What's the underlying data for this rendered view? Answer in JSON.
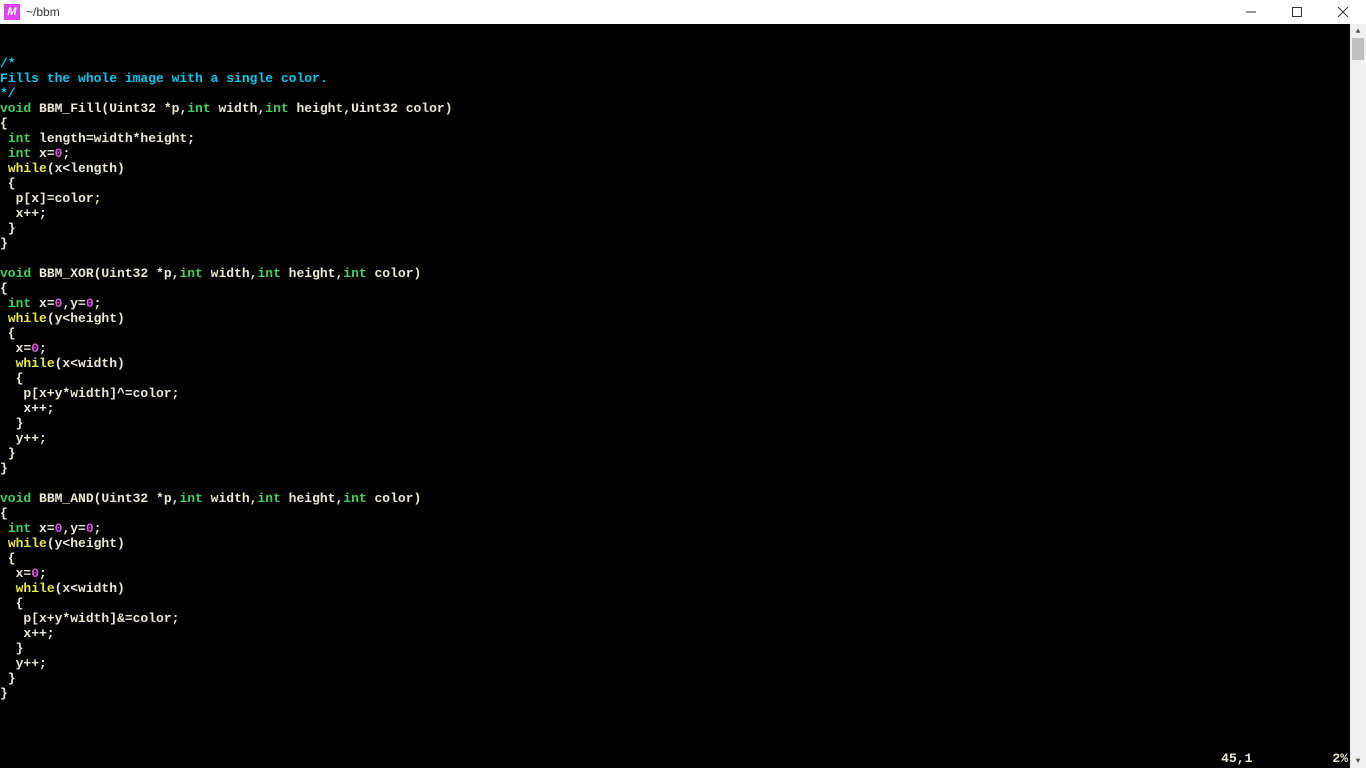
{
  "window": {
    "title": "~/bbm",
    "icon_glyph": "M"
  },
  "code": {
    "lines": [
      {
        "tokens": [
          {
            "t": "/*",
            "c": "c-comment"
          }
        ]
      },
      {
        "tokens": [
          {
            "t": "Fills the whole image with a single color.",
            "c": "c-comment"
          }
        ]
      },
      {
        "tokens": [
          {
            "t": "*/",
            "c": "c-comment"
          }
        ]
      },
      {
        "tokens": [
          {
            "t": "void",
            "c": "c-type"
          },
          {
            "t": " BBM_Fill(Uint32 *p,"
          },
          {
            "t": "int",
            "c": "c-type"
          },
          {
            "t": " width,"
          },
          {
            "t": "int",
            "c": "c-type"
          },
          {
            "t": " height,Uint32 color)"
          }
        ]
      },
      {
        "tokens": [
          {
            "t": "{"
          }
        ]
      },
      {
        "tokens": [
          {
            "t": " "
          },
          {
            "t": "int",
            "c": "c-type"
          },
          {
            "t": " length=width*height;"
          }
        ]
      },
      {
        "tokens": [
          {
            "t": " "
          },
          {
            "t": "int",
            "c": "c-type"
          },
          {
            "t": " x="
          },
          {
            "t": "0",
            "c": "c-number"
          },
          {
            "t": ";"
          }
        ]
      },
      {
        "tokens": [
          {
            "t": " "
          },
          {
            "t": "while",
            "c": "c-keyword"
          },
          {
            "t": "(x<length)"
          }
        ]
      },
      {
        "tokens": [
          {
            "t": " {"
          }
        ]
      },
      {
        "tokens": [
          {
            "t": "  p[x]=color;"
          }
        ]
      },
      {
        "tokens": [
          {
            "t": "  x++;"
          }
        ]
      },
      {
        "tokens": [
          {
            "t": " }"
          }
        ]
      },
      {
        "tokens": [
          {
            "t": "}"
          }
        ]
      },
      {
        "tokens": [
          {
            "t": " "
          }
        ]
      },
      {
        "tokens": [
          {
            "t": "void",
            "c": "c-type"
          },
          {
            "t": " BBM_XOR(Uint32 *p,"
          },
          {
            "t": "int",
            "c": "c-type"
          },
          {
            "t": " width,"
          },
          {
            "t": "int",
            "c": "c-type"
          },
          {
            "t": " height,"
          },
          {
            "t": "int",
            "c": "c-type"
          },
          {
            "t": " color)"
          }
        ]
      },
      {
        "tokens": [
          {
            "t": "{"
          }
        ]
      },
      {
        "tokens": [
          {
            "t": " "
          },
          {
            "t": "int",
            "c": "c-type"
          },
          {
            "t": " x="
          },
          {
            "t": "0",
            "c": "c-number"
          },
          {
            "t": ",y="
          },
          {
            "t": "0",
            "c": "c-number"
          },
          {
            "t": ";"
          }
        ]
      },
      {
        "tokens": [
          {
            "t": " "
          },
          {
            "t": "while",
            "c": "c-keyword"
          },
          {
            "t": "(y<height)"
          }
        ]
      },
      {
        "tokens": [
          {
            "t": " {"
          }
        ]
      },
      {
        "tokens": [
          {
            "t": "  x="
          },
          {
            "t": "0",
            "c": "c-number"
          },
          {
            "t": ";"
          }
        ]
      },
      {
        "tokens": [
          {
            "t": "  "
          },
          {
            "t": "while",
            "c": "c-keyword"
          },
          {
            "t": "(x<width)"
          }
        ]
      },
      {
        "tokens": [
          {
            "t": "  {"
          }
        ]
      },
      {
        "tokens": [
          {
            "t": "   p[x+y*width]^=color;"
          }
        ]
      },
      {
        "tokens": [
          {
            "t": "   x++;"
          }
        ]
      },
      {
        "tokens": [
          {
            "t": "  }"
          }
        ]
      },
      {
        "tokens": [
          {
            "t": "  y++;"
          }
        ]
      },
      {
        "tokens": [
          {
            "t": " }"
          }
        ]
      },
      {
        "tokens": [
          {
            "t": "}"
          }
        ]
      },
      {
        "tokens": [
          {
            "t": " "
          }
        ]
      },
      {
        "tokens": [
          {
            "t": "void",
            "c": "c-type"
          },
          {
            "t": " BBM_AND(Uint32 *p,"
          },
          {
            "t": "int",
            "c": "c-type"
          },
          {
            "t": " width,"
          },
          {
            "t": "int",
            "c": "c-type"
          },
          {
            "t": " height,"
          },
          {
            "t": "int",
            "c": "c-type"
          },
          {
            "t": " color)"
          }
        ]
      },
      {
        "tokens": [
          {
            "t": "{"
          }
        ]
      },
      {
        "tokens": [
          {
            "t": " "
          },
          {
            "t": "int",
            "c": "c-type"
          },
          {
            "t": " x="
          },
          {
            "t": "0",
            "c": "c-number"
          },
          {
            "t": ",y="
          },
          {
            "t": "0",
            "c": "c-number"
          },
          {
            "t": ";"
          }
        ]
      },
      {
        "tokens": [
          {
            "t": " "
          },
          {
            "t": "while",
            "c": "c-keyword"
          },
          {
            "t": "(y<height)"
          }
        ]
      },
      {
        "tokens": [
          {
            "t": " {"
          }
        ]
      },
      {
        "tokens": [
          {
            "t": "  x="
          },
          {
            "t": "0",
            "c": "c-number"
          },
          {
            "t": ";"
          }
        ]
      },
      {
        "tokens": [
          {
            "t": "  "
          },
          {
            "t": "while",
            "c": "c-keyword"
          },
          {
            "t": "(x<width)"
          }
        ]
      },
      {
        "tokens": [
          {
            "t": "  {"
          }
        ]
      },
      {
        "tokens": [
          {
            "t": "   p[x+y*width]&=color;"
          }
        ]
      },
      {
        "tokens": [
          {
            "t": "   x++;"
          }
        ]
      },
      {
        "tokens": [
          {
            "t": "  }"
          }
        ]
      },
      {
        "tokens": [
          {
            "t": "  y++;"
          }
        ]
      },
      {
        "tokens": [
          {
            "t": " }"
          }
        ]
      },
      {
        "tokens": [
          {
            "t": "}"
          }
        ]
      }
    ]
  },
  "status": {
    "position": "45,1",
    "percent": "2%"
  }
}
